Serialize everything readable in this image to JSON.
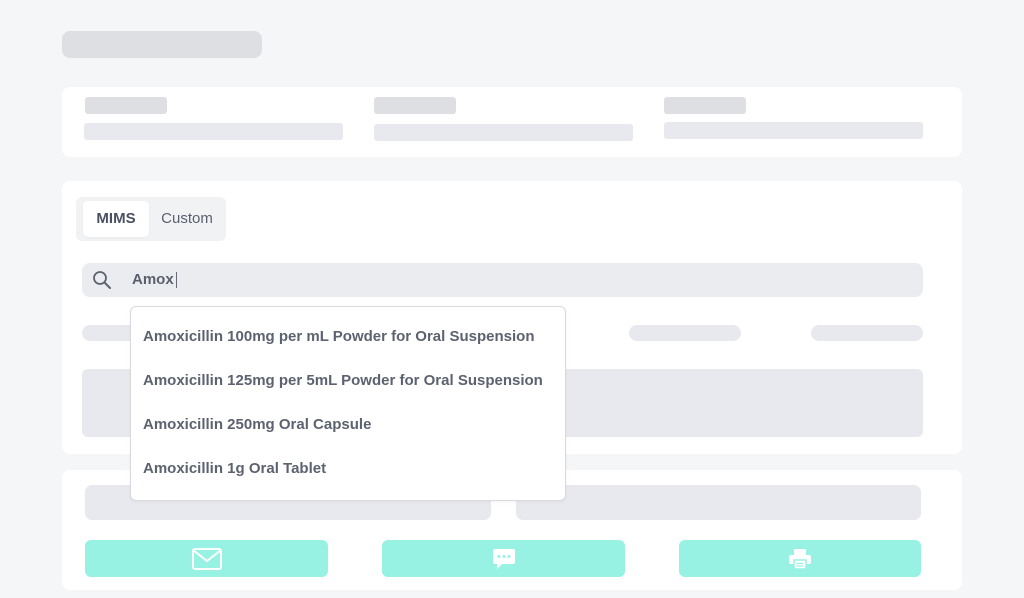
{
  "tabs": [
    {
      "label": "MIMS",
      "active": true
    },
    {
      "label": "Custom",
      "active": false
    }
  ],
  "search": {
    "value": "Amox",
    "icon": "search-icon"
  },
  "suggestions": [
    "Amoxicillin 100mg per mL Powder for Oral Suspension",
    "Amoxicillin 125mg per 5mL Powder for Oral Suspension",
    "Amoxicillin 250mg Oral Capsule",
    "Amoxicillin 1g Oral Tablet"
  ],
  "actions": [
    {
      "icon": "envelope-icon"
    },
    {
      "icon": "chat-bubble-icon"
    },
    {
      "icon": "printer-icon"
    }
  ],
  "colors": {
    "accent": "#98f2e3",
    "background": "#f5f6f8",
    "skeleton": "#e8e9ee"
  }
}
